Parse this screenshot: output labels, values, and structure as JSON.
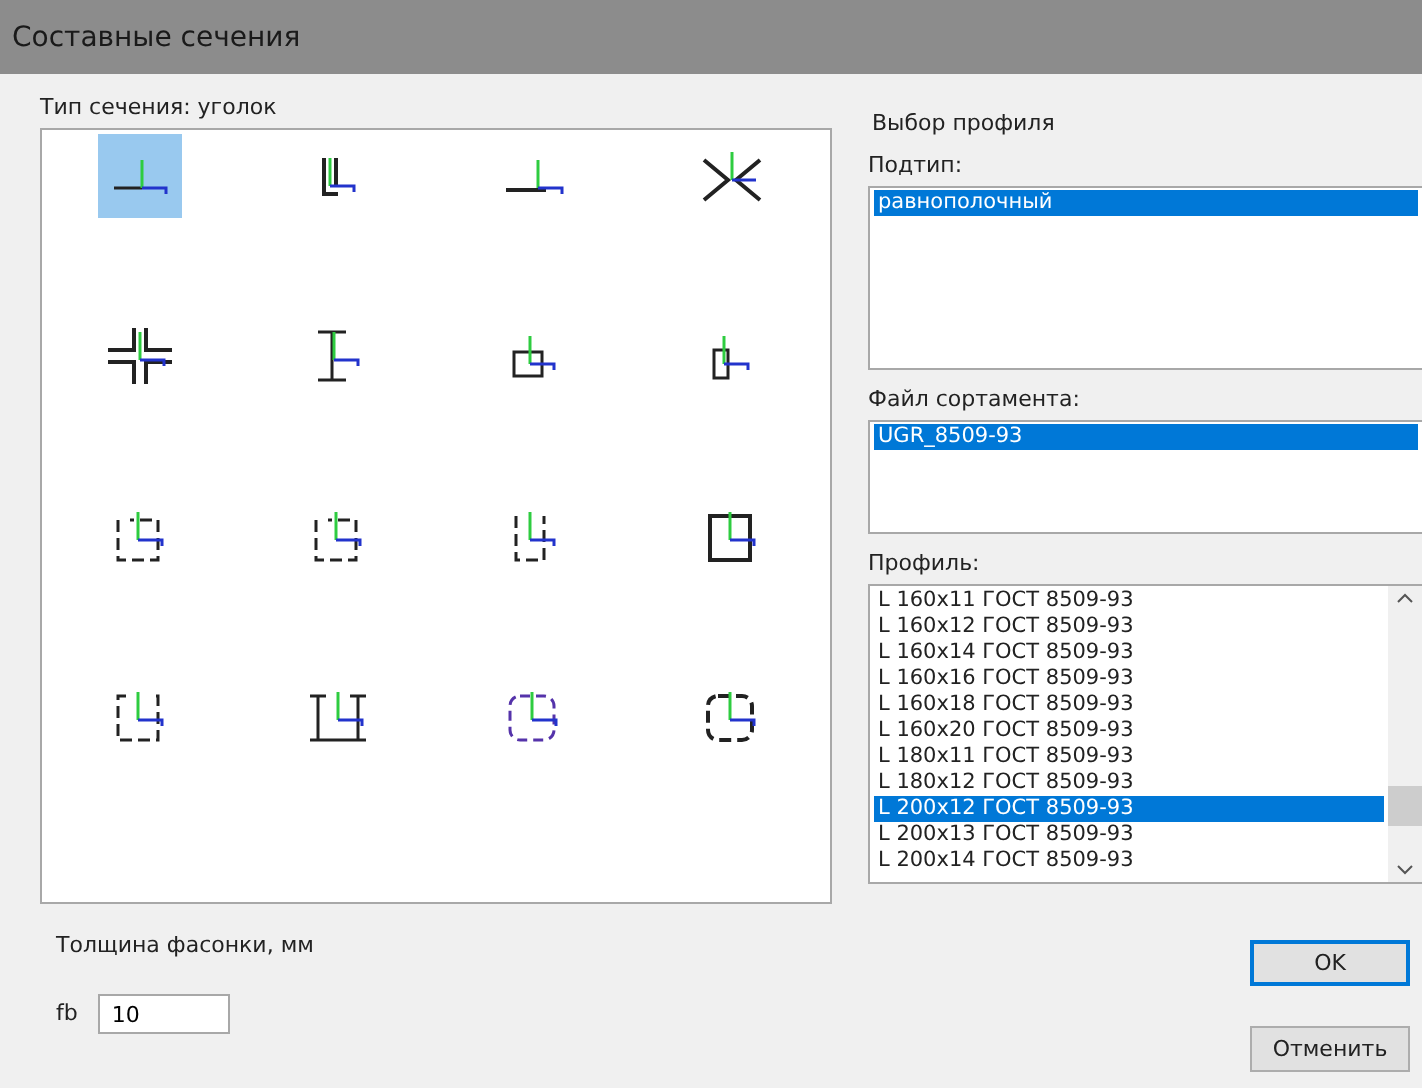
{
  "window": {
    "title": "Составные сечения"
  },
  "section_type": {
    "label": "Тип сечения: уголок",
    "items": [
      {
        "kind": "angle-up",
        "selected": true
      },
      {
        "kind": "angle-pair",
        "selected": false
      },
      {
        "kind": "angle-flat",
        "selected": false
      },
      {
        "kind": "angle-x",
        "selected": false
      },
      {
        "kind": "cross",
        "selected": false
      },
      {
        "kind": "i-pair",
        "selected": false
      },
      {
        "kind": "box-small",
        "selected": false
      },
      {
        "kind": "box-narrow",
        "selected": false
      },
      {
        "kind": "box-open",
        "selected": false
      },
      {
        "kind": "box-open",
        "selected": false
      },
      {
        "kind": "box-tall",
        "selected": false
      },
      {
        "kind": "box-closed",
        "selected": false
      },
      {
        "kind": "bracket",
        "selected": false
      },
      {
        "kind": "i-box",
        "selected": false
      },
      {
        "kind": "round-dashed",
        "selected": false
      },
      {
        "kind": "round-bold",
        "selected": false
      }
    ]
  },
  "profile_choice": {
    "title": "Выбор профиля",
    "subtype": {
      "label": "Подтип:",
      "items": [
        {
          "text": "равнополочный",
          "selected": true
        }
      ]
    },
    "assortment_file": {
      "label": "Файл сортамента:",
      "items": [
        {
          "text": "UGR_8509-93",
          "selected": true
        }
      ]
    },
    "profile": {
      "label": "Профиль:",
      "items": [
        {
          "text": "L 160x11 ГОСТ 8509-93",
          "selected": false
        },
        {
          "text": "L 160x12 ГОСТ 8509-93",
          "selected": false
        },
        {
          "text": "L 160x14 ГОСТ 8509-93",
          "selected": false
        },
        {
          "text": "L 160x16 ГОСТ 8509-93",
          "selected": false
        },
        {
          "text": "L 160x18 ГОСТ 8509-93",
          "selected": false
        },
        {
          "text": "L 160x20 ГОСТ 8509-93",
          "selected": false
        },
        {
          "text": "L 180x11 ГОСТ 8509-93",
          "selected": false
        },
        {
          "text": "L 180x12 ГОСТ 8509-93",
          "selected": false
        },
        {
          "text": "L 200x12 ГОСТ 8509-93",
          "selected": true
        },
        {
          "text": "L 200x13 ГОСТ 8509-93",
          "selected": false
        },
        {
          "text": "L 200x14 ГОСТ 8509-93",
          "selected": false
        }
      ]
    }
  },
  "gusset": {
    "label": "Толщина фасонки, мм",
    "field_label": "fb",
    "value": "10"
  },
  "buttons": [
    {
      "label": "OK",
      "default": true
    },
    {
      "label": "Отменить",
      "default": false
    }
  ]
}
